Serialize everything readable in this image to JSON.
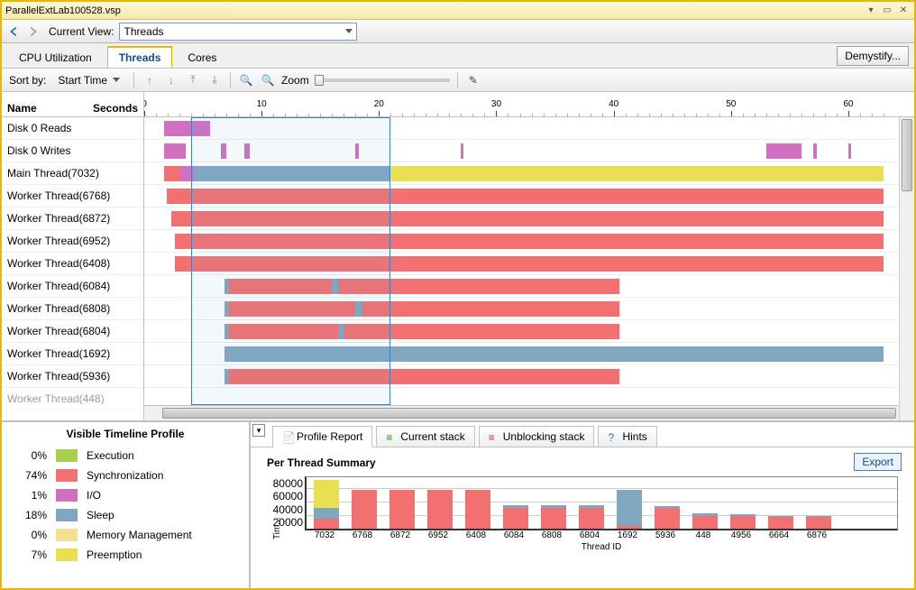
{
  "window": {
    "title": "ParallelExtLab100528.vsp"
  },
  "nav": {
    "current_view_label": "Current View:",
    "selected": "Threads"
  },
  "tabs": {
    "cpu": "CPU Utilization",
    "threads": "Threads",
    "cores": "Cores",
    "demystify": "Demystify..."
  },
  "toolbar": {
    "sortby_label": "Sort by:",
    "sortby_value": "Start Time",
    "zoom_label": "Zoom"
  },
  "timeline": {
    "header_name": "Name",
    "header_seconds": "Seconds",
    "max_seconds": 63,
    "ticks": [
      0,
      10,
      20,
      30,
      40,
      50,
      60
    ],
    "selection": {
      "start": 4,
      "end": 21
    },
    "rows": [
      {
        "label": "Disk 0 Reads",
        "segments": [
          {
            "t": "io",
            "s": 1.7,
            "e": 5.6
          }
        ]
      },
      {
        "label": "Disk 0 Writes",
        "segments": [
          {
            "t": "io",
            "s": 1.7,
            "e": 3.5
          },
          {
            "t": "io",
            "s": 6.5,
            "e": 7
          },
          {
            "t": "io",
            "s": 8.5,
            "e": 9
          },
          {
            "t": "io",
            "s": 18,
            "e": 18.3
          },
          {
            "t": "io",
            "s": 27,
            "e": 27.2
          },
          {
            "t": "io",
            "s": 53,
            "e": 56
          },
          {
            "t": "io",
            "s": 57,
            "e": 57.3
          },
          {
            "t": "io",
            "s": 60,
            "e": 60.2
          }
        ]
      },
      {
        "label": "Main Thread(7032)",
        "segments": [
          {
            "t": "sync",
            "s": 1.7,
            "e": 3.0
          },
          {
            "t": "io",
            "s": 3.0,
            "e": 4.2
          },
          {
            "t": "sleep",
            "s": 4.2,
            "e": 21
          },
          {
            "t": "preempt",
            "s": 21,
            "e": 63
          }
        ]
      },
      {
        "label": "Worker Thread(6768)",
        "segments": [
          {
            "t": "sync",
            "s": 1.9,
            "e": 63
          }
        ]
      },
      {
        "label": "Worker Thread(6872)",
        "segments": [
          {
            "t": "sync",
            "s": 2.3,
            "e": 63
          }
        ]
      },
      {
        "label": "Worker Thread(6952)",
        "segments": [
          {
            "t": "sync",
            "s": 2.6,
            "e": 63
          }
        ]
      },
      {
        "label": "Worker Thread(6408)",
        "segments": [
          {
            "t": "sync",
            "s": 2.6,
            "e": 63
          }
        ]
      },
      {
        "label": "Worker Thread(6084)",
        "segments": [
          {
            "t": "sleep",
            "s": 6.8,
            "e": 7.2
          },
          {
            "t": "sync",
            "s": 7.2,
            "e": 16
          },
          {
            "t": "sleep",
            "s": 16,
            "e": 16.5
          },
          {
            "t": "sync",
            "s": 16.5,
            "e": 40.5
          }
        ]
      },
      {
        "label": "Worker Thread(6808)",
        "segments": [
          {
            "t": "sleep",
            "s": 6.8,
            "e": 7.2
          },
          {
            "t": "sync",
            "s": 7.2,
            "e": 18
          },
          {
            "t": "sleep",
            "s": 18,
            "e": 18.5
          },
          {
            "t": "sync",
            "s": 18.5,
            "e": 40.5
          }
        ]
      },
      {
        "label": "Worker Thread(6804)",
        "segments": [
          {
            "t": "sleep",
            "s": 6.8,
            "e": 7.2
          },
          {
            "t": "sync",
            "s": 7.2,
            "e": 16.5
          },
          {
            "t": "sleep",
            "s": 16.5,
            "e": 17
          },
          {
            "t": "sync",
            "s": 17,
            "e": 40.5
          }
        ]
      },
      {
        "label": "Worker Thread(1692)",
        "segments": [
          {
            "t": "sleep",
            "s": 6.8,
            "e": 63
          }
        ]
      },
      {
        "label": "Worker Thread(5936)",
        "segments": [
          {
            "t": "sleep",
            "s": 6.8,
            "e": 7.2
          },
          {
            "t": "sync",
            "s": 7.2,
            "e": 40.5
          }
        ]
      },
      {
        "label": "Worker Thread(448)",
        "segments": []
      }
    ]
  },
  "legend": {
    "title": "Visible Timeline Profile",
    "items": [
      {
        "pct": "0%",
        "name": "Execution",
        "color": "#a8d050"
      },
      {
        "pct": "74%",
        "name": "Synchronization",
        "color": "#f27070"
      },
      {
        "pct": "1%",
        "name": "I/O",
        "color": "#d070c0"
      },
      {
        "pct": "18%",
        "name": "Sleep",
        "color": "#7fa8c0"
      },
      {
        "pct": "0%",
        "name": "Memory Management",
        "color": "#f2e090"
      },
      {
        "pct": "7%",
        "name": "Preemption",
        "color": "#e8e050"
      }
    ]
  },
  "report": {
    "tabs": {
      "profile": "Profile Report",
      "stack": "Current stack",
      "unblock": "Unblocking stack",
      "hints": "Hints"
    },
    "heading": "Per Thread Summary",
    "export": "Export",
    "y_label": "Tim...",
    "x_label": "Thread ID"
  },
  "chart_data": {
    "type": "bar",
    "title": "Per Thread Summary",
    "xlabel": "Thread ID",
    "ylabel": "Time",
    "ylim": [
      0,
      80000
    ],
    "yticks": [
      20000,
      40000,
      60000,
      80000
    ],
    "categories": [
      "7032",
      "6768",
      "6872",
      "6952",
      "6408",
      "6084",
      "6808",
      "6804",
      "1692",
      "5936",
      "448",
      "4956",
      "6664",
      "6876"
    ],
    "series": [
      {
        "name": "Synchronization",
        "color": "#f27070",
        "values": [
          15000,
          60000,
          60000,
          60000,
          60000,
          32000,
          32000,
          32000,
          4000,
          32000,
          20000,
          20000,
          18000,
          18000
        ]
      },
      {
        "name": "Sleep",
        "color": "#7fa8c0",
        "values": [
          17000,
          0,
          0,
          0,
          0,
          4000,
          4000,
          4000,
          56000,
          2000,
          4000,
          2000,
          2000,
          2000
        ]
      },
      {
        "name": "Preemption",
        "color": "#e8e050",
        "values": [
          42000,
          0,
          0,
          0,
          0,
          0,
          0,
          0,
          0,
          0,
          0,
          0,
          0,
          0
        ]
      }
    ]
  }
}
